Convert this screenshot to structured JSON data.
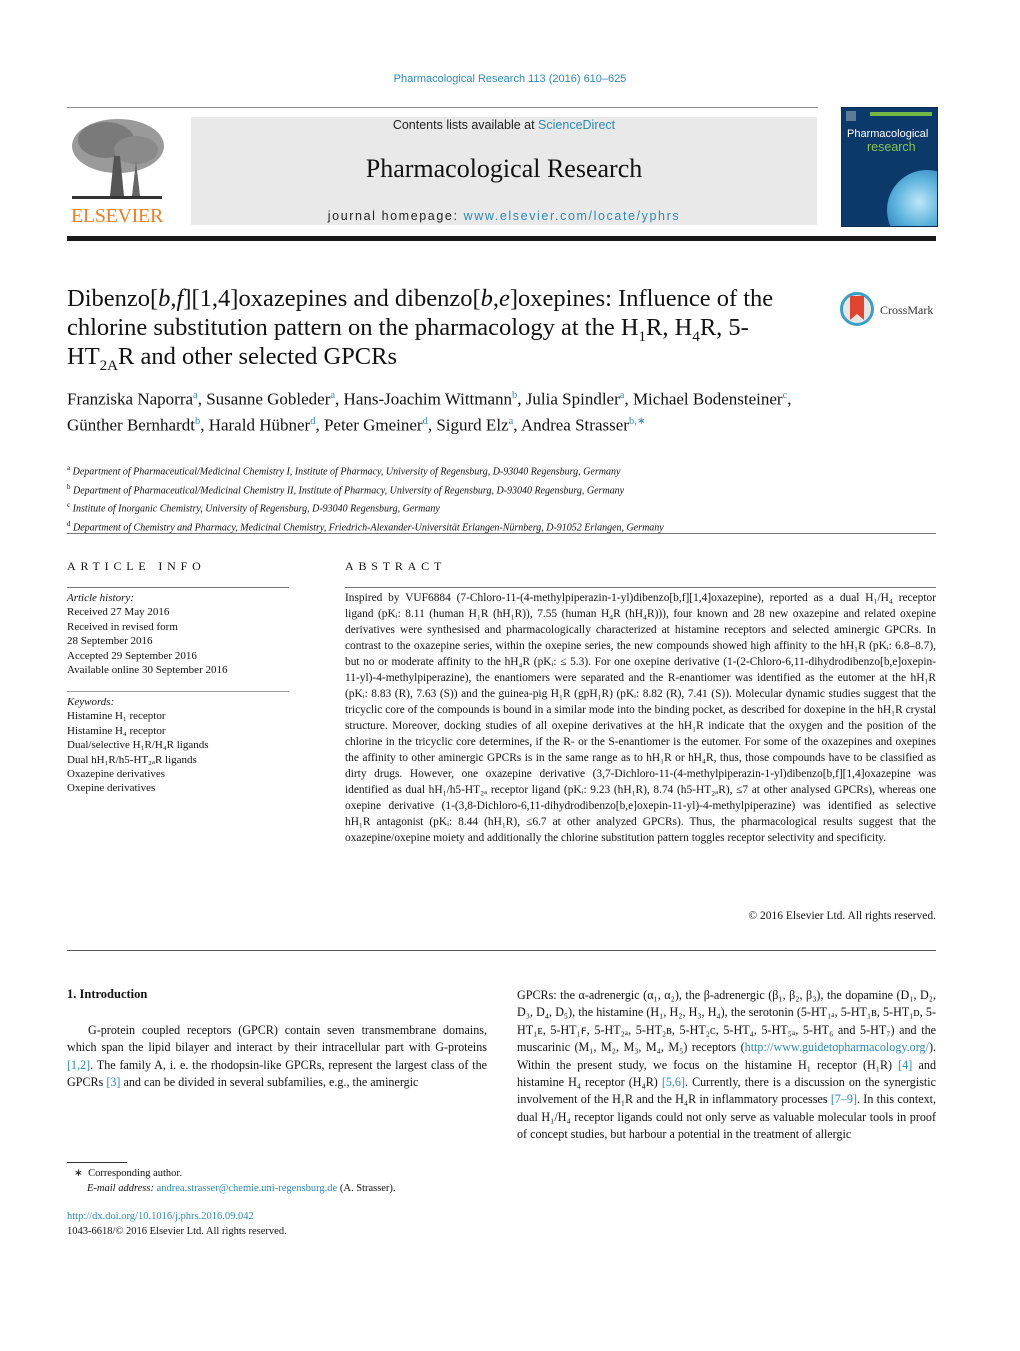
{
  "header": {
    "citation": "Pharmacological Research 113 (2016) 610–625",
    "contents_prefix": "Contents lists available at ",
    "contents_link": "ScienceDirect",
    "journal_name": "Pharmacological Research",
    "homepage_prefix": "journal homepage: ",
    "homepage_link": "www.elsevier.com/locate/yphrs",
    "publisher_logo_text": "ELSEVIER",
    "cover_title_1": "Pharmacological",
    "cover_title_2": "research",
    "crossmark_label": "CrossMark"
  },
  "article": {
    "title_parts": [
      "Dibenzo[",
      "b",
      ",",
      "f",
      "][1,4]oxazepines and dibenzo[",
      "b",
      ",",
      "e",
      "]oxepines: Influence of the chlorine substitution pattern on the pharmacology at the H",
      "1",
      "R, H",
      "4",
      "R, 5-HT",
      "2A",
      "R and other selected GPCRs"
    ],
    "authors": [
      {
        "name": "Franziska Naporra",
        "aff": "a"
      },
      {
        "name": "Susanne Gobleder",
        "aff": "a"
      },
      {
        "name": "Hans-Joachim Wittmann",
        "aff": "b"
      },
      {
        "name": "Julia Spindler",
        "aff": "a"
      },
      {
        "name": "Michael Bodensteiner",
        "aff": "c"
      },
      {
        "name": "Günther Bernhardt",
        "aff": "b"
      },
      {
        "name": "Harald Hübner",
        "aff": "d"
      },
      {
        "name": "Peter Gmeiner",
        "aff": "d"
      },
      {
        "name": "Sigurd Elz",
        "aff": "a"
      },
      {
        "name": "Andrea Strasser",
        "aff": "b,∗"
      }
    ],
    "affiliations": [
      {
        "key": "a",
        "text": "Department of Pharmaceutical/Medicinal Chemistry I, Institute of Pharmacy, University of Regensburg, D-93040 Regensburg, Germany"
      },
      {
        "key": "b",
        "text": "Department of Pharmaceutical/Medicinal Chemistry II, Institute of Pharmacy, University of Regensburg, D-93040 Regensburg, Germany"
      },
      {
        "key": "c",
        "text": "Institute of Inorganic Chemistry, University of Regensburg, D-93040 Regensburg, Germany"
      },
      {
        "key": "d",
        "text": "Department of Chemistry and Pharmacy, Medicinal Chemistry, Friedrich-Alexander-Universität Erlangen-Nürnberg, D-91052 Erlangen, Germany"
      }
    ]
  },
  "article_info": {
    "heading": "ARTICLE INFO",
    "history_label": "Article history:",
    "history": [
      "Received 27 May 2016",
      "Received in revised form",
      "28 September 2016",
      "Accepted 29 September 2016",
      "Available online 30 September 2016"
    ],
    "keywords_label": "Keywords:",
    "keywords": [
      "Histamine H₁ receptor",
      "Histamine H₄ receptor",
      "Dual/selective H₁R/H₄R ligands",
      "Dual hH₁R/h5-HT₂ₐR ligands",
      "Oxazepine derivatives",
      "Oxepine derivatives"
    ]
  },
  "abstract": {
    "heading": "ABSTRACT",
    "text": "Inspired by VUF6884 (7-Chloro-11-(4-methylpiperazin-1-yl)dibenzo[b,f][1,4]oxazepine), reported as a dual H₁/H₄ receptor ligand (pKᵢ: 8.11 (human H₁R (hH₁R)), 7.55 (human H₄R (hH₄R))), four known and 28 new oxazepine and related oxepine derivatives were synthesised and pharmacologically characterized at histamine receptors and selected aminergic GPCRs. In contrast to the oxazepine series, within the oxepine series, the new compounds showed high affinity to the hH₁R (pKᵢ: 6.8–8.7), but no or moderate affinity to the hH₄R (pKᵢ: ≤ 5.3). For one oxepine derivative (1-(2-Chloro-6,11-dihydrodibenzo[b,e]oxepin-11-yl)-4-methylpiperazine), the enantiomers were separated and the R-enantiomer was identified as the eutomer at the hH₁R (pKᵢ: 8.83 (R), 7.63 (S)) and the guinea-pig H₁R (gpH₁R) (pKᵢ: 8.82 (R), 7.41 (S)). Molecular dynamic studies suggest that the tricyclic core of the compounds is bound in a similar mode into the binding pocket, as described for doxepine in the hH₁R crystal structure. Moreover, docking studies of all oxepine derivatives at the hH₁R indicate that the oxygen and the position of the chlorine in the tricyclic core determines, if the R- or the S-enantiomer is the eutomer. For some of the oxazepines and oxepines the affinity to other aminergic GPCRs is in the same range as to hH₁R or hH₄R, thus, those compounds have to be classified as dirty drugs. However, one oxazepine derivative (3,7-Dichloro-11-(4-methylpiperazin-1-yl)dibenzo[b,f][1,4]oxazepine was identified as dual hH₁/h5-HT₂ₐ receptor ligand (pKᵢ: 9.23 (hH₁R), 8.74 (h5-HT₂ₐR), ≤7 at other analysed GPCRs), whereas one oxepine derivative (1-(3,8-Dichloro-6,11-dihydrodibenzo[b,e]oxepin-11-yl)-4-methylpiperazine) was identified as selective hH₁R antagonist (pKᵢ: 8.44 (hH₁R), ≤6.7 at other analyzed GPCRs). Thus, the pharmacological results suggest that the oxazepine/oxepine moiety and additionally the chlorine substitution pattern toggles receptor selectivity and specificity.",
    "copyright": "© 2016 Elsevier Ltd. All rights reserved."
  },
  "introduction": {
    "heading": "1.  Introduction",
    "left_segments": [
      {
        "t": "G-protein coupled receptors (GPCR) contain seven transmembrane domains, which span the lipid bilayer and interact by their intracellular part with G-proteins "
      },
      {
        "t": "[1,2]",
        "link": true
      },
      {
        "t": ". The family A, i. e. the rhodopsin-like GPCRs, represent the largest class of the GPCRs "
      },
      {
        "t": "[3]",
        "link": true
      },
      {
        "t": " and can be divided in several subfamilies, e.g., the aminergic"
      }
    ],
    "right_segments": [
      {
        "t": "GPCRs: the α-adrenergic (α₁, α₂), the β-adrenergic (β₁, β₂, β₃), the dopamine (D₁, D₂, D₃, D₄, D₅), the histamine (H₁, H₂, H₃, H₄), the serotonin (5-HT₁ₐ, 5-HT₁ʙ, 5-HT₁ᴅ, 5-HT₁ᴇ, 5-HT₁ꜰ, 5-HT₂ₐ, 5-HT₂ʙ, 5-HT₂ᴄ, 5-HT₄, 5-HT₅ₐ, 5-HT₆ and 5-HT₇) and the muscarinic (M₁, M₂, M₃, M₄, M₅) receptors ("
      },
      {
        "t": "http://www.guidetopharmacology.org/",
        "link": true
      },
      {
        "t": "). Within the present study, we focus on the histamine H₁ receptor (H₁R) "
      },
      {
        "t": "[4]",
        "link": true
      },
      {
        "t": " and histamine H₄ receptor (H₄R) "
      },
      {
        "t": "[5,6]",
        "link": true
      },
      {
        "t": ". Currently, there is a discussion on the synergistic involvement of the H₁R and the H₄R in inflammatory processes "
      },
      {
        "t": "[7–9]",
        "link": true
      },
      {
        "t": ". In this context, dual H₁/H₄ receptor ligands could not only serve as valuable molecular tools in proof of concept studies, but harbour a potential in the treatment of allergic"
      }
    ]
  },
  "footnotes": {
    "corresponding_marker": "∗",
    "corresponding_text": "Corresponding author.",
    "email_label": "E-mail address: ",
    "email": "andrea.strasser@chemie.uni-regensburg.de",
    "email_suffix": " (A. Strasser).",
    "doi": "http://dx.doi.org/10.1016/j.phrs.2016.09.042",
    "issn_copyright": "1043-6618/© 2016 Elsevier Ltd. All rights reserved."
  },
  "colors": {
    "link": "#2b8ab8",
    "elsevier_orange": "#f07c1f",
    "journal_box_bg": "#e9e9e9",
    "cover_blue": "#0b3a6a",
    "cover_green": "#8ac44b"
  }
}
